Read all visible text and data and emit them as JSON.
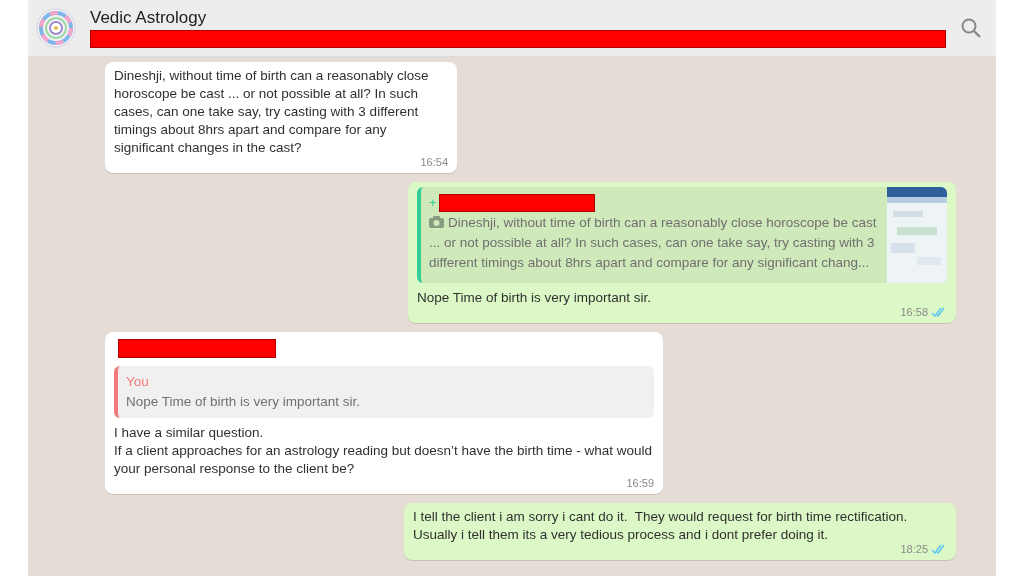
{
  "header": {
    "title": "Vedic Astrology",
    "subtitle_redacted": true
  },
  "messages": [
    {
      "kind": "incoming",
      "text": "Dineshji, without time of birth can a reasonably close horoscope be cast ... or not possible at all? In such cases, can one take say, try casting with 3 different timings about 8hrs apart and compare for any significant changes in the cast?",
      "time": "16:54"
    },
    {
      "kind": "outgoing",
      "quote": {
        "sender_redacted": true,
        "sender_prefix": "+",
        "photo": true,
        "text": "Dineshji, without time of birth can a reasonably close horoscope be cast ... or not possible at all? In such cases, can one take say, try casting with 3 different timings about 8hrs apart and compare for any significant chang..."
      },
      "text": "Nope Time of birth is very important sir.",
      "time": "16:58",
      "read": true
    },
    {
      "kind": "incoming",
      "sender_redacted": true,
      "quote": {
        "sender": "You",
        "text": "Nope Time of birth is very important sir."
      },
      "text": "I have a similar question.\nIf a client approaches for an astrology reading but doesn’t have the birth time - what would your personal response to the client be?",
      "time": "16:59"
    },
    {
      "kind": "outgoing",
      "text": "I tell the client i am sorry i cant do it.  They would request for birth time rectification. Usually i tell them its a very tedious process and i dont prefer doing it.",
      "time": "18:25",
      "read": true
    }
  ]
}
